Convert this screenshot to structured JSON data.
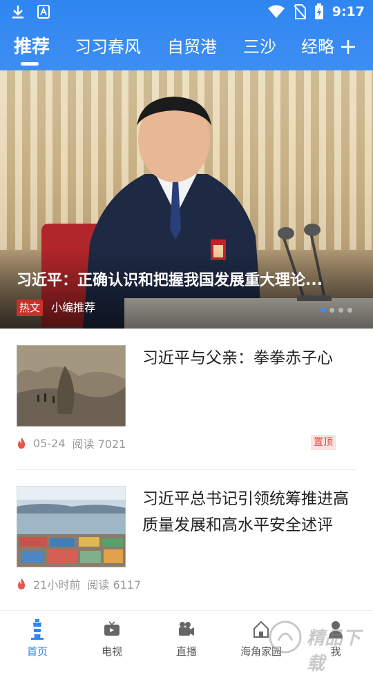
{
  "status_bar": {
    "time": "9:17",
    "icons": [
      "download-icon",
      "app-a-icon",
      "wifi-icon",
      "no-sim-icon",
      "battery-charging-icon"
    ]
  },
  "tabs": [
    {
      "label": "推荐",
      "active": true
    },
    {
      "label": "习习春风",
      "active": false
    },
    {
      "label": "自贸港",
      "active": false
    },
    {
      "label": "三沙",
      "active": false
    },
    {
      "label": "经略",
      "active": false
    }
  ],
  "hero": {
    "title": "习近平：正确认识和把握我国发展重大理论...",
    "badge": "热文",
    "subtitle": "小编推荐",
    "slide_index": 0,
    "slide_count": 4
  },
  "articles": [
    {
      "title": "习近平与父亲：拳拳赤子心",
      "date": "05-24",
      "read_label": "阅读 7021",
      "pinned_label": "置顶"
    },
    {
      "title": "习近平总书记引领统筹推进高质量发展和高水平安全述评",
      "date": "21小时前",
      "read_label": "阅读 6117"
    }
  ],
  "bottom_nav": [
    {
      "label": "首页",
      "icon": "lighthouse-icon",
      "active": true
    },
    {
      "label": "电视",
      "icon": "tv-icon",
      "active": false
    },
    {
      "label": "直播",
      "icon": "video-camera-icon",
      "active": false
    },
    {
      "label": "海角家园",
      "icon": "home-icon",
      "active": false
    },
    {
      "label": "我",
      "icon": "user-icon",
      "active": false
    }
  ],
  "watermark": "精品下载",
  "colors": {
    "accent": "#2f86f0",
    "badge_red": "#c9312c",
    "pin_red": "#d9483f"
  }
}
